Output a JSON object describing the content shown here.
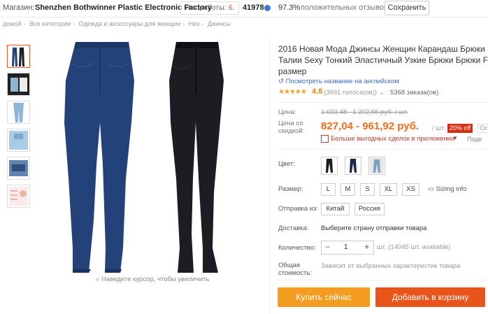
{
  "store": {
    "label": "Магазин:",
    "name": "Shenzhen Bothwinner Plastic Electronic Factory",
    "years_label": "Лет работы:",
    "years_value": "6",
    "years_suffix": ".",
    "score": "41978",
    "positive_pct": "97.3%",
    "feedback_label": "положительных отзывов",
    "save_label": "Сохранить"
  },
  "breadcrumb": [
    "домой",
    "Все категории",
    "Одежда и аксессуары для женщин",
    "Низ",
    "Джинсы"
  ],
  "product": {
    "title_lines": [
      "2016 Новая Мода Джинсы Женщин Карандаш Брюки Высо",
      "Талии Sexy Тонкий Эластичный Узкие Брюки Брюки Fit La",
      "размер"
    ],
    "translate_link": "Посмотреть название на английском",
    "stars": "★★★★★",
    "rating": "4.8",
    "reviews": "(3691 голоса(ов))",
    "orders": "5368 заказа(ов)",
    "zoom_hint": "Наведите курсор, чтобы увеличить"
  },
  "price": {
    "label": "Цена:",
    "old": "1 033,48 - 1 202,56 руб. / шт.",
    "discount_label_1": "Цена со",
    "discount_label_2": "скидкой:",
    "new": "827,04 - 961,92 руб.",
    "per": "/ шт.",
    "off": "20% off",
    "off2": "Ос",
    "app_deal": "Больше выгодных сделок в приложении",
    "share": "Поде"
  },
  "options": {
    "color_label": "Цвет:",
    "size_label": "Размер:",
    "sizes": [
      "L",
      "M",
      "S",
      "XL",
      "XS"
    ],
    "sizing_info": "Sizing info",
    "ship_label": "Отправка из:",
    "ship_from": [
      "Китай",
      "Россия"
    ],
    "delivery_label": "Доставка:",
    "delivery_value": "Выберите страну отправки товара",
    "qty_label": "Количество:",
    "qty_minus": "−",
    "qty_value": "1",
    "qty_plus": "+",
    "qty_available": "шт. (14045 шт. available)",
    "total_label_1": "Общая",
    "total_label_2": "стоимость:",
    "total_value": "Зависит от выбранных характеристик товара"
  },
  "actions": {
    "buy_now": "Купить сейчас",
    "add_to_cart": "Добавить в корзину"
  },
  "colors": {
    "accent": "#e9541b",
    "buy_now_bg": "#f39c20",
    "price": "#f06c1b",
    "deal_red": "#c0392b",
    "denim_blue": "#23427a",
    "denim_black": "#1b1d22"
  },
  "icons": {
    "zoom": "search-icon",
    "translate": "translate-icon",
    "sizing": "ruler-icon",
    "app_deal": "qr-code-icon"
  }
}
